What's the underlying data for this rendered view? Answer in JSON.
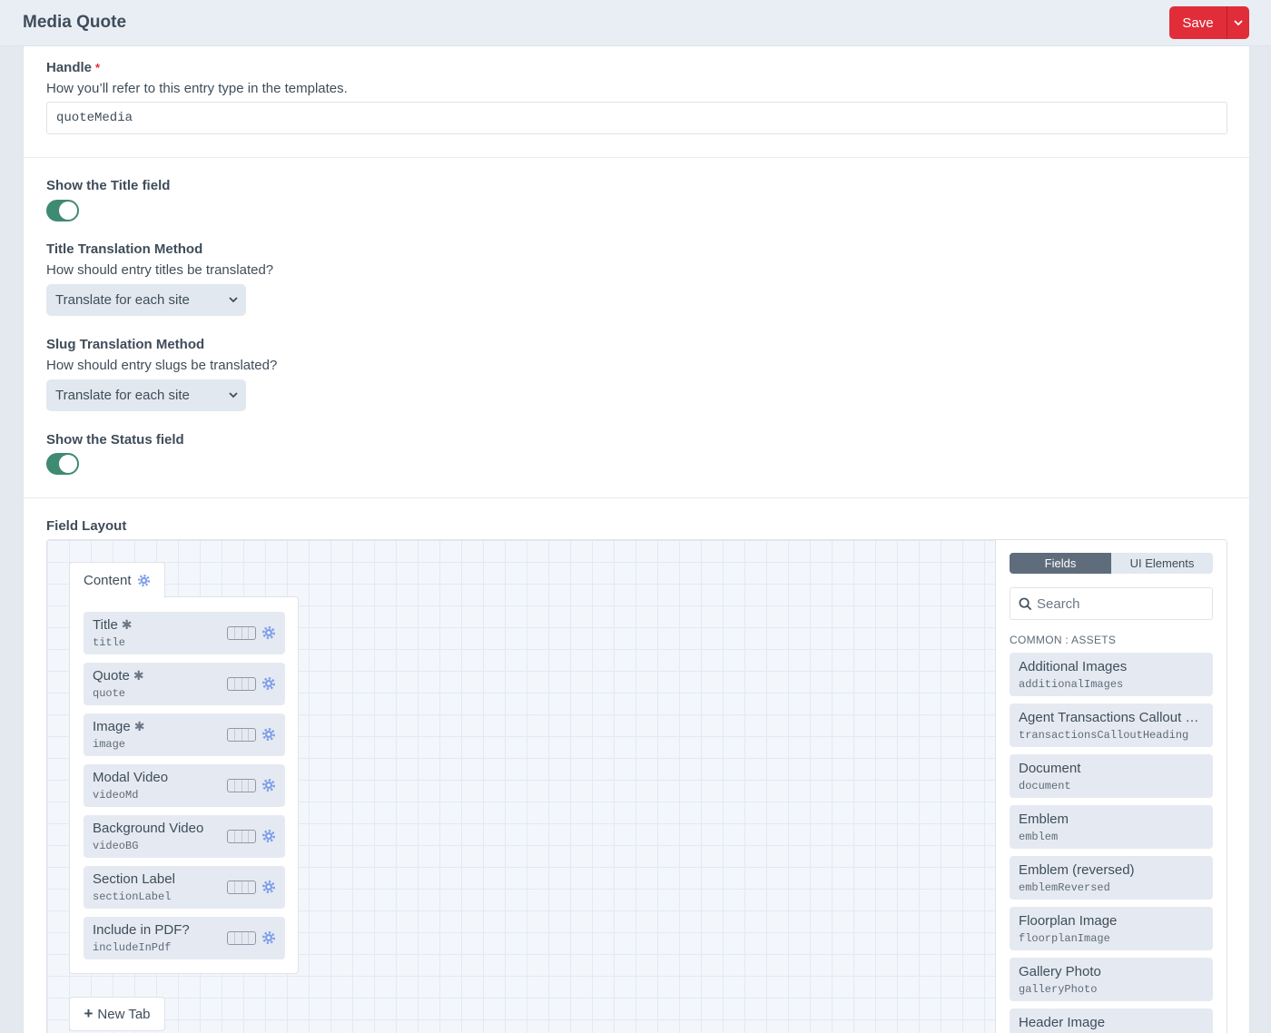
{
  "header": {
    "title": "Media Quote",
    "save_label": "Save"
  },
  "handle": {
    "label": "Handle",
    "required_mark": "*",
    "instructions": "How you’ll refer to this entry type in the templates.",
    "value": "quoteMedia"
  },
  "show_title": {
    "label": "Show the Title field",
    "enabled": true
  },
  "title_translation": {
    "label": "Title Translation Method",
    "instructions": "How should entry titles be translated?",
    "selected": "Translate for each site"
  },
  "slug_translation": {
    "label": "Slug Translation Method",
    "instructions": "How should entry slugs be translated?",
    "selected": "Translate for each site"
  },
  "show_status": {
    "label": "Show the Status field",
    "enabled": true
  },
  "field_layout": {
    "label": "Field Layout",
    "tab_name": "Content",
    "new_tab_label": "New Tab",
    "fields": [
      {
        "name": "Title",
        "handle": "title",
        "required": "✱"
      },
      {
        "name": "Quote",
        "handle": "quote",
        "required": "✱"
      },
      {
        "name": "Image",
        "handle": "image",
        "required": "✱"
      },
      {
        "name": "Modal Video",
        "handle": "videoMd",
        "required": ""
      },
      {
        "name": "Background Video",
        "handle": "videoBG",
        "required": ""
      },
      {
        "name": "Section Label",
        "handle": "sectionLabel",
        "required": ""
      },
      {
        "name": "Include in PDF?",
        "handle": "includeInPdf",
        "required": ""
      }
    ],
    "library": {
      "tabs": [
        "Fields",
        "UI Elements"
      ],
      "search_placeholder": "Search",
      "group": "COMMON : ASSETS",
      "items": [
        {
          "name": "Additional Images",
          "handle": "additionalImages"
        },
        {
          "name": "Agent Transactions Callout Heading",
          "handle": "transactionsCalloutHeading"
        },
        {
          "name": "Document",
          "handle": "document"
        },
        {
          "name": "Emblem",
          "handle": "emblem"
        },
        {
          "name": "Emblem (reversed)",
          "handle": "emblemReversed"
        },
        {
          "name": "Floorplan Image",
          "handle": "floorplanImage"
        },
        {
          "name": "Gallery Photo",
          "handle": "galleryPhoto"
        },
        {
          "name": "Header Image",
          "handle": ""
        }
      ]
    }
  },
  "colors": {
    "accent_red": "#e12d39",
    "toggle_on": "#3f8a72",
    "gear_blue": "#7f9ee8"
  },
  "icons": {
    "save_menu": "chevron-down-icon",
    "settings": "gear-icon",
    "search": "search-icon",
    "add": "plus-icon"
  }
}
